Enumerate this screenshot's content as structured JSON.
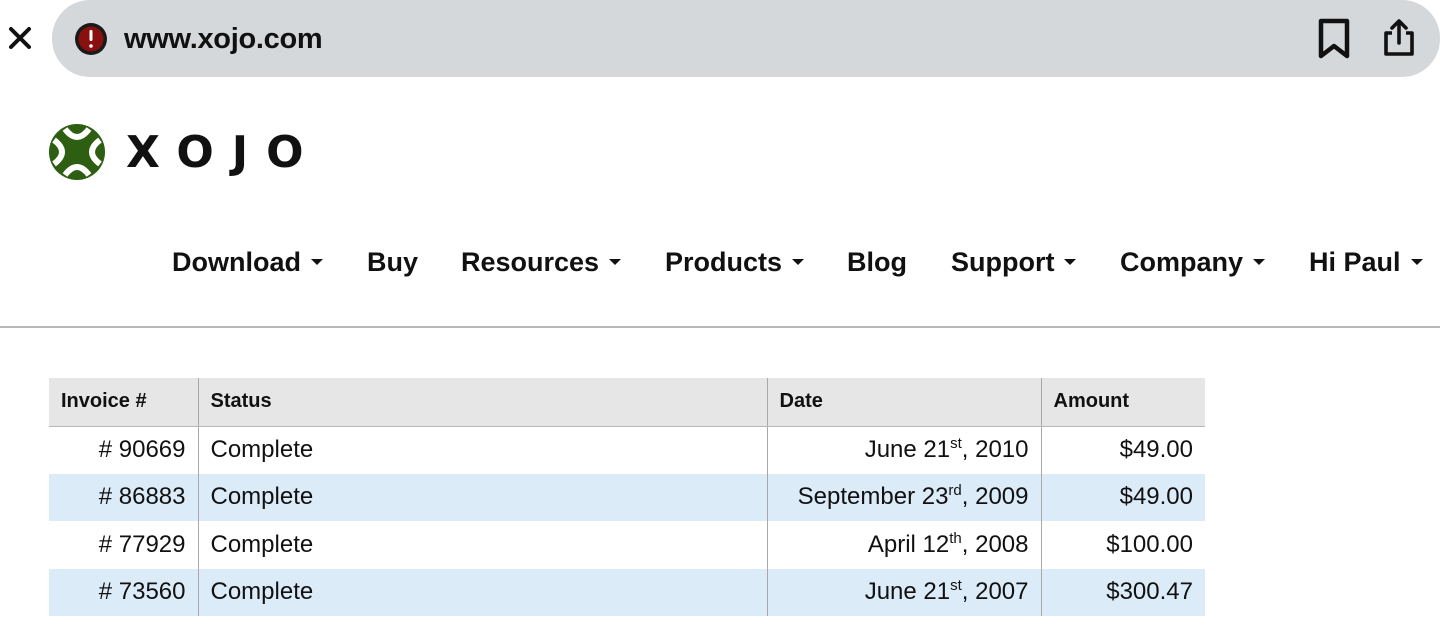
{
  "browser": {
    "url": "www.xojo.com",
    "icons": [
      "close-icon",
      "site-warning-icon",
      "bookmark-icon",
      "share-icon"
    ]
  },
  "logo": {
    "text": "XOJO",
    "mark_color": "#2d5e12"
  },
  "nav": {
    "items": [
      {
        "label": "Download",
        "dropdown": true
      },
      {
        "label": "Buy",
        "dropdown": false
      },
      {
        "label": "Resources",
        "dropdown": true
      },
      {
        "label": "Products",
        "dropdown": true
      },
      {
        "label": "Blog",
        "dropdown": false
      },
      {
        "label": "Support",
        "dropdown": true
      },
      {
        "label": "Company",
        "dropdown": true
      },
      {
        "label": "Hi Paul",
        "dropdown": true
      }
    ]
  },
  "table": {
    "headers": [
      "Invoice #",
      "Status",
      "Date",
      "Amount"
    ],
    "rows": [
      {
        "invoice": "# 90669",
        "status": "Complete",
        "date_pre": "June 21",
        "date_sup": "st",
        "date_post": ", 2010",
        "amount": "$49.00"
      },
      {
        "invoice": "# 86883",
        "status": "Complete",
        "date_pre": "September 23",
        "date_sup": "rd",
        "date_post": ", 2009",
        "amount": "$49.00"
      },
      {
        "invoice": "# 77929",
        "status": "Complete",
        "date_pre": "April 12",
        "date_sup": "th",
        "date_post": ", 2008",
        "amount": "$100.00"
      },
      {
        "invoice": "# 73560",
        "status": "Complete",
        "date_pre": "June 21",
        "date_sup": "st",
        "date_post": ", 2007",
        "amount": "$300.47"
      }
    ],
    "alt_row_color": "#dcebf8",
    "header_bg": "#e6e6e6"
  }
}
